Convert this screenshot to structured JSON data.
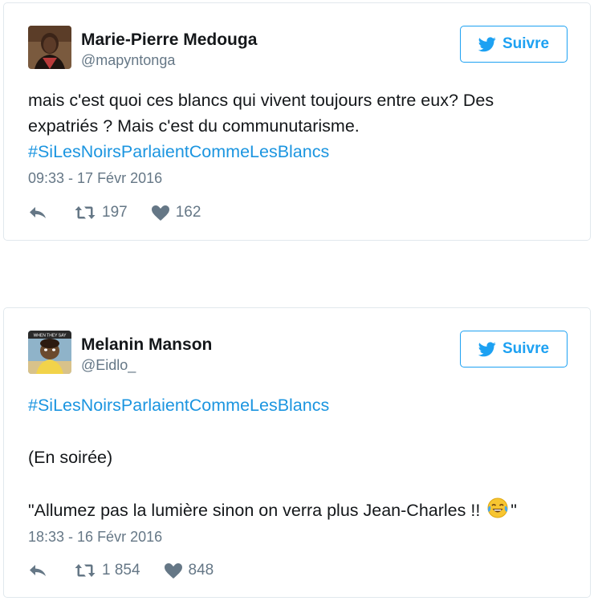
{
  "tweets": [
    {
      "author_name": "Marie-Pierre Medouga",
      "handle": "@mapyntonga",
      "follow_label": "Suivre",
      "text_line1": "mais c'est quoi ces blancs qui vivent toujours entre eux? Des",
      "text_line2": "expatriés ? Mais c'est du communutarisme.",
      "hashtag": "#SiLesNoirsParlaientCommeLesBlancs",
      "timestamp": "09:33 - 17 Févr 2016",
      "retweets": "197",
      "likes": "162"
    },
    {
      "author_name": "Melanin Manson",
      "handle": "@Eidlo_",
      "follow_label": "Suivre",
      "hashtag": "#SiLesNoirsParlaientCommeLesBlancs",
      "text_line1": "(En soirée)",
      "text_line2": "\"Allumez pas la lumière sinon on verra plus Jean-Charles !!",
      "text_line2_end": "\"",
      "emoji_name": "face-with-tears-of-joy",
      "timestamp": "18:33 - 16 Févr 2016",
      "retweets": "1 854",
      "likes": "848",
      "avatar_caption": "WHEN THEY SAY"
    }
  ],
  "colors": {
    "link": "#1b95e0",
    "twitter_blue": "#1da1f2",
    "meta_gray": "#657786",
    "border": "#e1e8ed"
  },
  "icons": [
    "twitter-bird-icon",
    "reply-icon",
    "retweet-icon",
    "heart-icon"
  ]
}
